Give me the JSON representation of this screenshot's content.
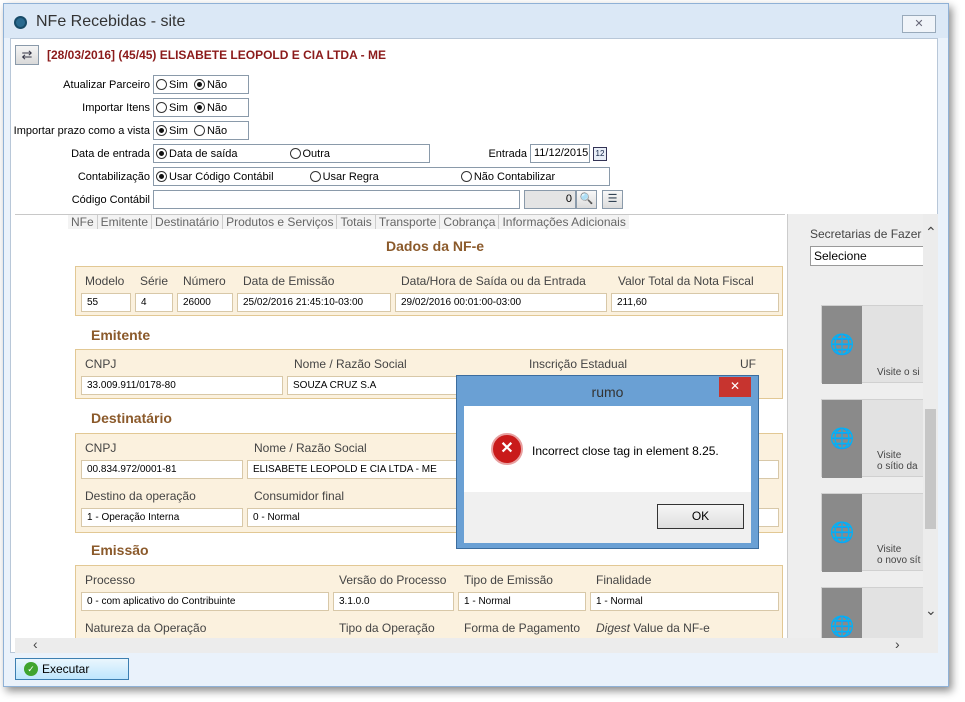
{
  "window": {
    "title": "NFe Recebidas - site"
  },
  "header": {
    "text": "[28/03/2016] (45/45) ELISABETE LEOPOLD E CIA LTDA - ME"
  },
  "form": {
    "atualizar_parceiro": {
      "label": "Atualizar Parceiro",
      "opt1": "Sim",
      "opt2": "Não"
    },
    "importar_itens": {
      "label": "Importar Itens",
      "opt1": "Sim",
      "opt2": "Não"
    },
    "importar_prazo": {
      "label": "Importar prazo como a vista",
      "opt1": "Sim",
      "opt2": "Não"
    },
    "data_entrada": {
      "label": "Data de entrada",
      "opt1": "Data de saída",
      "opt2": "Outra",
      "entrada_label": "Entrada",
      "entrada_value": "11/12/2015"
    },
    "contabilizacao": {
      "label": "Contabilização",
      "opt1": "Usar Código Contábil",
      "opt2": "Usar Regra",
      "opt3": "Não Contabilizar"
    },
    "codigo_contabil": {
      "label": "Código Contábil",
      "value": "",
      "number": "0"
    }
  },
  "tabs": [
    "NFe",
    "Emitente",
    "Destinatário",
    "Produtos e Serviços",
    "Totais",
    "Transporte",
    "Cobrança",
    "Informações Adicionais"
  ],
  "nfe": {
    "dados_title": "Dados da NF-e",
    "dados": {
      "modelo_label": "Modelo",
      "modelo": "55",
      "serie_label": "Série",
      "serie": "4",
      "numero_label": "Número",
      "numero": "26000",
      "emissao_label": "Data de Emissão",
      "emissao": "25/02/2016 21:45:10-03:00",
      "saida_label": "Data/Hora de Saída ou da Entrada",
      "saida": "29/02/2016 00:01:00-03:00",
      "valor_label": "Valor Total da Nota Fiscal",
      "valor": "211,60"
    },
    "emitente_title": "Emitente",
    "emitente": {
      "cnpj_label": "CNPJ",
      "cnpj": "33.009.911/0178-80",
      "nome_label": "Nome / Razão Social",
      "nome": "SOUZA CRUZ S.A",
      "ie_label": "Inscrição Estadual",
      "uf_label": "UF"
    },
    "destinatario_title": "Destinatário",
    "destinatario": {
      "cnpj_label": "CNPJ",
      "cnpj": "00.834.972/0001-81",
      "nome_label": "Nome / Razão Social",
      "nome": "ELISABETE LEOPOLD E CIA LTDA - ME",
      "destino_label": "Destino da operação",
      "destino": "1 - Operação Interna",
      "consumidor_label": "Consumidor final",
      "consumidor": "0 - Normal"
    },
    "emissao_title": "Emissão",
    "emissao": {
      "processo_label": "Processo",
      "processo": "0 - com aplicativo do Contribuinte",
      "versao_label": "Versão do Processo",
      "versao": "3.1.0.0",
      "tipo_label": "Tipo de Emissão",
      "tipo": "1 - Normal",
      "finalidade_label": "Finalidade",
      "finalidade": "1 - Normal",
      "natureza_label": "Natureza da Operação",
      "tipo_op_label": "Tipo da Operação",
      "pagamento_label": "Forma de Pagamento",
      "digest_italic": "Digest",
      "digest_rest": " Value da NF-e"
    }
  },
  "right_panel": {
    "label": "Secretarias de Fazer",
    "select": "Selecione",
    "card1_text": "Visite o si",
    "card2_text1": "Visite",
    "card2_text2": "o sítio da",
    "card3_text1": "Visite",
    "card3_text2": "o novo sít"
  },
  "footer": {
    "execute_label": "Executar"
  },
  "dialog": {
    "title": "rumo",
    "close": "✕",
    "message": "Incorrect close tag in element 8.25.",
    "ok": "OK"
  },
  "colors": {
    "section_title": "#8b5a2b",
    "box_bg": "#fbf1de",
    "header_text": "#8b1a1a",
    "dialog_frame": "#6aa0d4"
  }
}
